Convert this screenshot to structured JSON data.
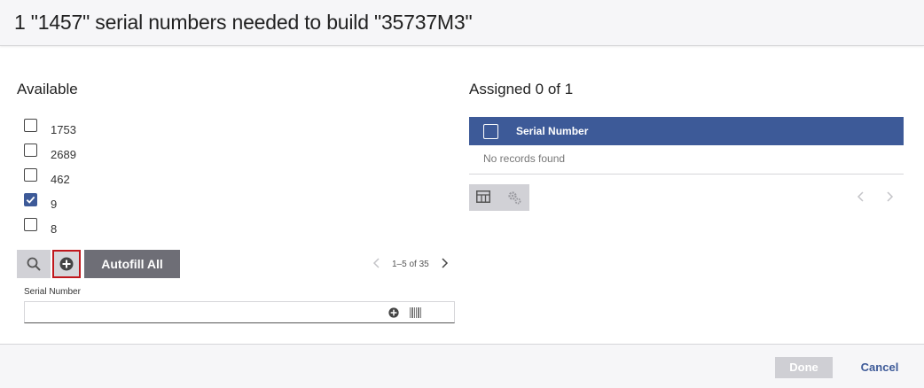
{
  "header": {
    "title": "1 \"1457\" serial numbers needed to build \"35737M3\""
  },
  "available": {
    "title": "Available",
    "items": [
      {
        "label": "1753",
        "checked": false
      },
      {
        "label": "2689",
        "checked": false
      },
      {
        "label": "462",
        "checked": false
      },
      {
        "label": "9",
        "checked": true
      },
      {
        "label": "8",
        "checked": false
      }
    ],
    "toolbar": {
      "search_icon": "search-icon",
      "add_icon": "plus-circle-icon",
      "autofill_label": "Autofill All"
    },
    "pager": {
      "text": "1–5 of 35"
    },
    "serial_number": {
      "label": "Serial Number",
      "value": "",
      "placeholder": ""
    }
  },
  "assigned": {
    "title": "Assigned 0 of 1",
    "grid": {
      "column_header": "Serial Number",
      "empty_text": "No records found"
    }
  },
  "footer": {
    "done_label": "Done",
    "cancel_label": "Cancel"
  },
  "colors": {
    "accent": "#3d5a98",
    "highlight_border": "#c0171c",
    "toolbar_bg": "#d1d1d6",
    "autofill_bg": "#6e6e76"
  }
}
